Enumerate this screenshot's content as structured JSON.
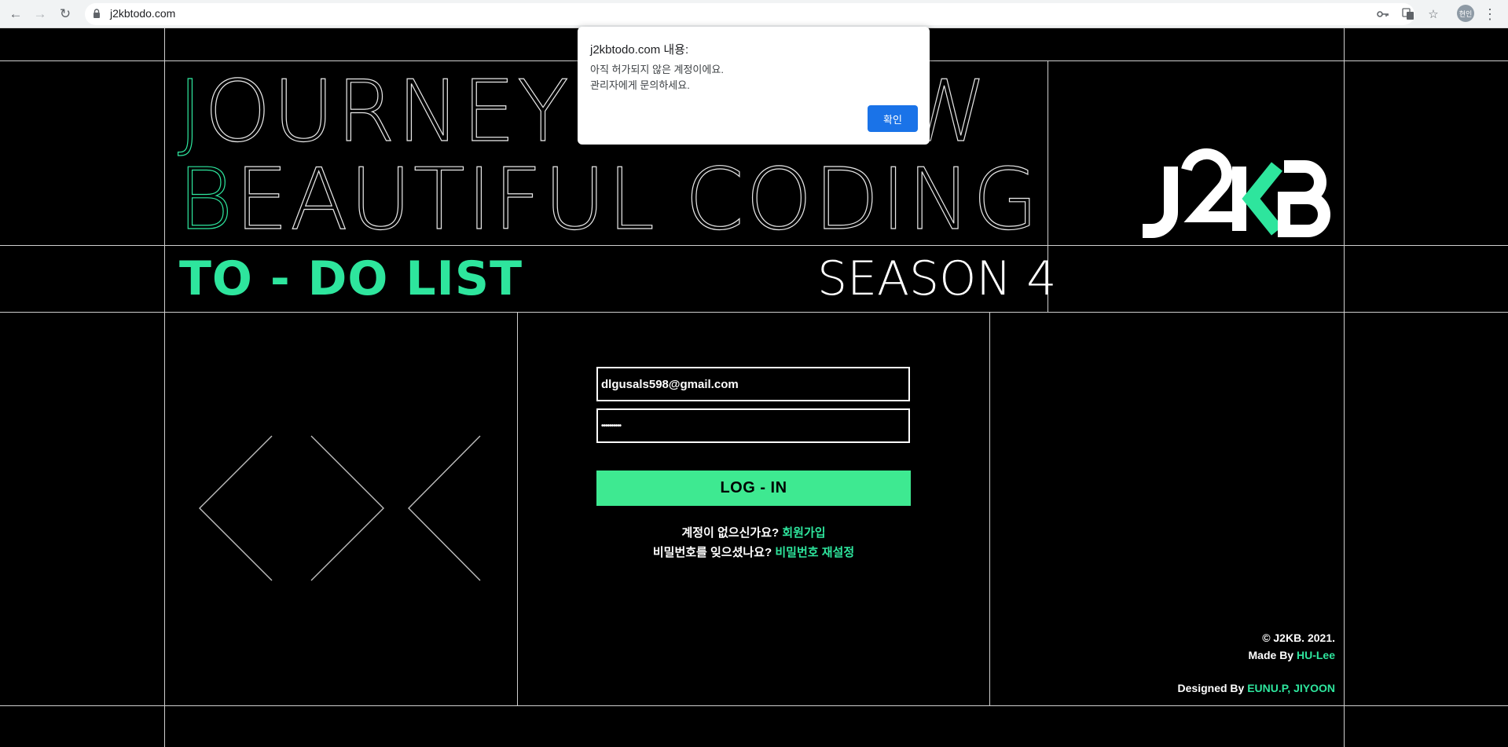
{
  "browser": {
    "url": "j2kbtodo.com",
    "profile_initials": "현인"
  },
  "hero": {
    "line1_first": "J",
    "line1_rest": "OURNEY TO WOW",
    "line2_first": "B",
    "line2_rest": "EAUTIFUL CODING",
    "subtitle": "TO - DO LIST",
    "season": "SEASON 4"
  },
  "logo": {
    "text": "J2KB",
    "accent_color": "#2ee59d"
  },
  "login": {
    "email_value": "dlgusals598@gmail.com",
    "password_value": "••••••••••",
    "button_label": "LOG - IN",
    "signup_prompt": "계정이 없으신가요?",
    "signup_link": "회원가입",
    "reset_prompt": "비밀번호를 잊으셨나요?",
    "reset_link": "비밀번호 재설정"
  },
  "credits": {
    "copyright": "© J2KB. 2021.",
    "made_by_label": "Made By",
    "made_by_name": "HU-Lee",
    "designed_by_label": "Designed By",
    "designed_by_names": "EUNU.P, JIYOON"
  },
  "dialog": {
    "title": "j2kbtodo.com 내용:",
    "message_line1": "아직 허가되지 않은 계정이에요.",
    "message_line2": "관리자에게 문의하세요.",
    "confirm_label": "확인"
  },
  "colors": {
    "accent": "#2ee59d",
    "button": "#3ee991",
    "background": "#000000",
    "dialog_button": "#1a73e8"
  }
}
